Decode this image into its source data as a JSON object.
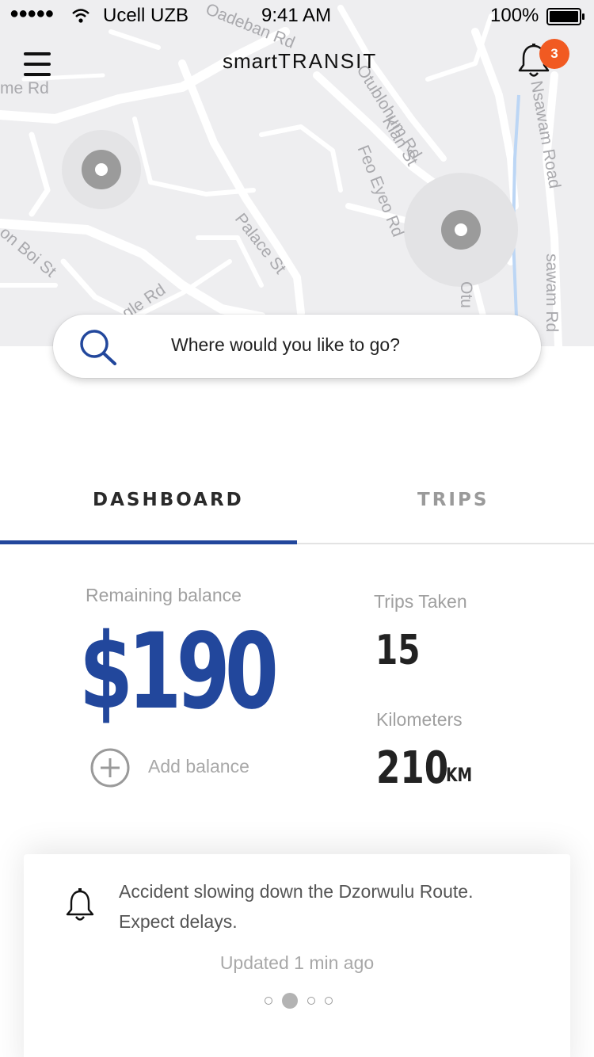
{
  "status_bar": {
    "signal": "●●●●●",
    "carrier": "Ucell UZB",
    "time": "9:41 AM",
    "battery_pct": "100%"
  },
  "header": {
    "logo_light": "smart",
    "logo_bold": "TRANSIT",
    "notification_count": "3"
  },
  "map": {
    "street_labels": [
      "me Rd",
      "Oadeban Rd",
      "Otublohum Rd",
      "Klan St",
      "Feo Eyeo Rd",
      "Nsawam Road",
      "Palace St",
      "on Boi St",
      "gle Rd",
      "Otu",
      "sawam Rd"
    ]
  },
  "search": {
    "placeholder": "Where would you like to go?"
  },
  "tabs": [
    {
      "label": "DASHBOARD",
      "active": true
    },
    {
      "label": "TRIPS",
      "active": false
    }
  ],
  "dashboard": {
    "balance_label": "Remaining balance",
    "balance_value": "$190",
    "add_balance_label": "Add balance",
    "trips_label": "Trips Taken",
    "trips_value": "15",
    "km_label": "Kilometers",
    "km_value": "210",
    "km_unit": "KM"
  },
  "alert": {
    "message": "Accident slowing down the Dzorwulu Route. Expect delays.",
    "updated": "Updated 1 min ago",
    "pager": {
      "count": 4,
      "active_index": 1
    }
  },
  "colors": {
    "accent": "#22479c",
    "badge": "#f15a22",
    "map_bg": "#eeeef0"
  }
}
